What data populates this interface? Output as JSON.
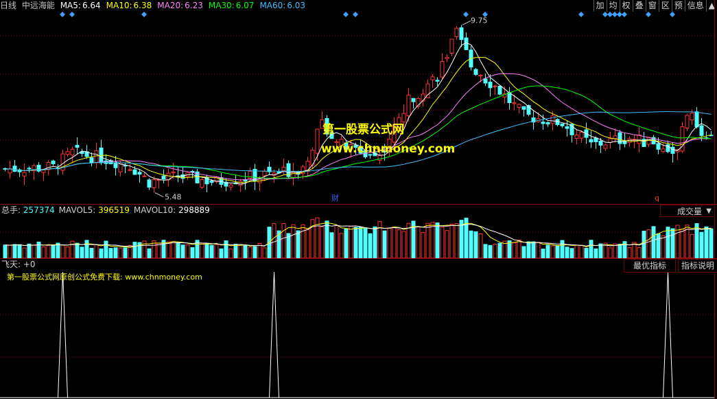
{
  "header": {
    "period": "日线",
    "stock_name": "中远海能",
    "ma_items": [
      {
        "label": "MA5:",
        "value": "6.64",
        "color": "#ffffff"
      },
      {
        "label": "MA10:",
        "value": "6.38",
        "color": "#ffff00"
      },
      {
        "label": "MA20:",
        "value": "6.23",
        "color": "#ff80ff"
      },
      {
        "label": "MA30:",
        "value": "6.07",
        "color": "#00ff00"
      },
      {
        "label": "MA60:",
        "value": "6.03",
        "color": "#40c0ff"
      }
    ]
  },
  "toolbar": {
    "buttons": [
      "加",
      "均",
      "权",
      "叠",
      "窗",
      "区",
      "预",
      "信息",
      "▲"
    ]
  },
  "price_panel": {
    "high_label": "9.75",
    "low_label": "5.48",
    "finance_marker": "财",
    "right_marker": "q",
    "watermark_title": "第一股票公式网",
    "watermark_url": "www.chnmoney.com"
  },
  "volume_panel": {
    "items": [
      {
        "label": "总手:",
        "value": "257374",
        "color": "#40ffff"
      },
      {
        "label": "MAVOL5:",
        "value": "396519",
        "color": "#ffff00"
      },
      {
        "label": "MAVOL10:",
        "value": "298889",
        "color": "#ffffff"
      }
    ],
    "indicator_select": "成交量",
    "dropdown_arrow": "▼"
  },
  "indicator_panel": {
    "label": "飞天:",
    "value": "+0",
    "note": "第一股票公式网原创公式免费下载: www.chnmoney.com",
    "best_button": "最优指标",
    "help_button": "指标说明"
  },
  "colors": {
    "up": "#ff3232",
    "down": "#54ffff",
    "grid": "#8b0000",
    "diamond": "#40a0ff",
    "watermark": "#ffff00"
  },
  "chart_data": {
    "type": "candlestick",
    "price_max_label": 9.75,
    "price_min_label": 5.48,
    "ma_values": {
      "MA5": 6.64,
      "MA10": 6.38,
      "MA20": 6.23,
      "MA30": 6.07,
      "MA60": 6.03
    },
    "volume": {
      "last": 257374,
      "MAVOL5": 396519,
      "MAVOL10": 298889
    },
    "indicator_signal_bars": [
      12,
      56,
      138
    ]
  }
}
